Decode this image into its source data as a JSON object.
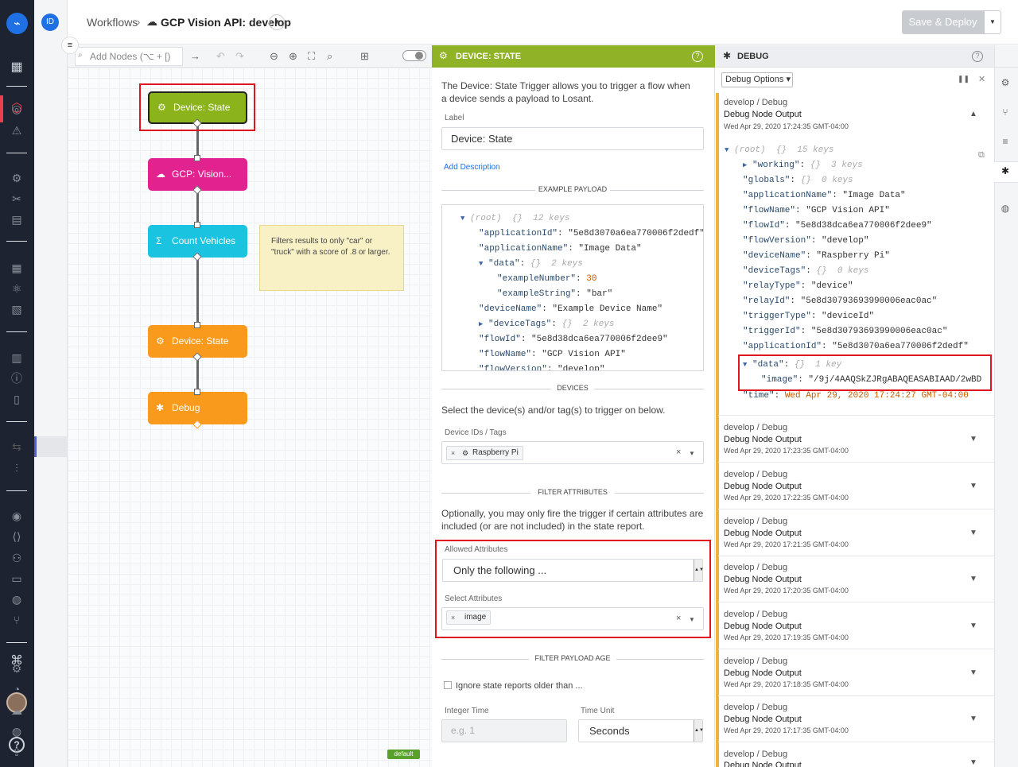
{
  "header": {
    "user_initials": "ID",
    "breadcrumb": "Workflows",
    "crumb_sep": "›",
    "workflow_name": "GCP Vision API: develop",
    "save_deploy": "Save & Deploy"
  },
  "toolbar": {
    "add_nodes_placeholder": "Add Nodes (⌥ + [)"
  },
  "nodes": [
    {
      "label": "Device: State",
      "color": "#8ab31c"
    },
    {
      "label": "GCP: Vision...",
      "color": "#e2238f"
    },
    {
      "label": "Count Vehicles",
      "color": "#1ac3e0"
    },
    {
      "label": "Device: State",
      "color": "#f99a1d"
    },
    {
      "label": "Debug",
      "color": "#f99a1d"
    }
  ],
  "sticky_note": "Filters results to only \"car\" or \"truck\" with a score of .8 or larger.",
  "branch_tag": "default",
  "properties": {
    "title": "DEVICE: STATE",
    "description": "The Device: State Trigger allows you to trigger a flow when a device sends a payload to Losant.",
    "label_caption": "Label",
    "label_value": "Device: State",
    "add_description": "Add Description",
    "example_payload_title": "EXAMPLE PAYLOAD",
    "payload": {
      "root_meta": "(root)  {}  12 keys",
      "applicationId_key": "\"applicationId\"",
      "applicationId_val": "\"5e8d3070a6ea770006f2dedf\"",
      "applicationName_key": "\"applicationName\"",
      "applicationName_val": "\"Image Data\"",
      "data_key": "\"data\"",
      "data_meta": "{}  2 keys",
      "exampleNumber_key": "\"exampleNumber\"",
      "exampleNumber_val": "30",
      "exampleString_key": "\"exampleString\"",
      "exampleString_val": "\"bar\"",
      "deviceName_key": "\"deviceName\"",
      "deviceName_val": "\"Example Device Name\"",
      "deviceTags_key": "\"deviceTags\"",
      "deviceTags_meta": "{}  2 keys",
      "flowId_key": "\"flowId\"",
      "flowId_val": "\"5e8d38dca6ea770006f2dee9\"",
      "flowName_key": "\"flowName\"",
      "flowName_val": "\"GCP Vision API\"",
      "flowVersion_key": "\"flowVersion\"",
      "flowVersion_val": "\"develop\""
    },
    "devices_title": "DEVICES",
    "devices_text": "Select the device(s) and/or tag(s) to trigger on below.",
    "device_ids_label": "Device IDs / Tags",
    "device_chip": "Raspberry Pi",
    "filter_attrs_title": "FILTER ATTRIBUTES",
    "filter_attrs_text": "Optionally, you may only fire the trigger if certain attributes are included (or are not included) in the state report.",
    "allowed_label": "Allowed Attributes",
    "allowed_value": "Only the following ...",
    "select_attrs_label": "Select Attributes",
    "attr_chip": "image",
    "filter_age_title": "FILTER PAYLOAD AGE",
    "ignore_label": "Ignore state reports older than ...",
    "integer_time_label": "Integer Time",
    "integer_time_placeholder": "e.g. 1",
    "time_unit_label": "Time Unit",
    "time_unit_value": "Seconds"
  },
  "debug": {
    "title": "DEBUG",
    "options": "Debug Options",
    "messages": [
      {
        "path": "develop / Debug",
        "title": "Debug Node Output",
        "time": "Wed Apr 29, 2020 17:24:35 GMT-04:00"
      },
      {
        "path": "develop / Debug",
        "title": "Debug Node Output",
        "time": "Wed Apr 29, 2020 17:23:35 GMT-04:00"
      },
      {
        "path": "develop / Debug",
        "title": "Debug Node Output",
        "time": "Wed Apr 29, 2020 17:22:35 GMT-04:00"
      },
      {
        "path": "develop / Debug",
        "title": "Debug Node Output",
        "time": "Wed Apr 29, 2020 17:21:35 GMT-04:00"
      },
      {
        "path": "develop / Debug",
        "title": "Debug Node Output",
        "time": "Wed Apr 29, 2020 17:20:35 GMT-04:00"
      },
      {
        "path": "develop / Debug",
        "title": "Debug Node Output",
        "time": "Wed Apr 29, 2020 17:19:35 GMT-04:00"
      },
      {
        "path": "develop / Debug",
        "title": "Debug Node Output",
        "time": "Wed Apr 29, 2020 17:18:35 GMT-04:00"
      },
      {
        "path": "develop / Debug",
        "title": "Debug Node Output",
        "time": "Wed Apr 29, 2020 17:17:35 GMT-04:00"
      },
      {
        "path": "develop / Debug",
        "title": "Debug Node Output",
        "time": ""
      }
    ],
    "tree": {
      "root_meta": "(root)  {}  15 keys",
      "working_key": "\"working\"",
      "working_meta": "{}  3 keys",
      "globals_key": "\"globals\"",
      "globals_meta": "{}  0 keys",
      "applicationName_key": "\"applicationName\"",
      "applicationName_val": "\"Image Data\"",
      "flowName_key": "\"flowName\"",
      "flowName_val": "\"GCP Vision API\"",
      "flowId_key": "\"flowId\"",
      "flowId_val": "\"5e8d38dca6ea770006f2dee9\"",
      "flowVersion_key": "\"flowVersion\"",
      "flowVersion_val": "\"develop\"",
      "deviceName_key": "\"deviceName\"",
      "deviceName_val": "\"Raspberry Pi\"",
      "deviceTags_key": "\"deviceTags\"",
      "deviceTags_meta": "{}  0 keys",
      "relayType_key": "\"relayType\"",
      "relayType_val": "\"device\"",
      "relayId_key": "\"relayId\"",
      "relayId_val": "\"5e8d30793693990006eac0ac\"",
      "triggerType_key": "\"triggerType\"",
      "triggerType_val": "\"deviceId\"",
      "triggerId_key": "\"triggerId\"",
      "triggerId_val": "\"5e8d30793693990006eac0ac\"",
      "applicationId_key": "\"applicationId\"",
      "applicationId_val": "\"5e8d3070a6ea770006f2dedf\"",
      "data_key": "\"data\"",
      "data_meta": "{}  1 key",
      "image_key": "\"image\"",
      "image_val": "\"/9j/4AAQSkZJRgABAQEASABIAAD/2wBD",
      "time_key": "\"time\"",
      "time_val": "Wed Apr 29, 2020 17:24:27 GMT-04:00"
    }
  },
  "colors": {
    "accent": "#8fb226",
    "highlight": "#e0141e",
    "debug_bar": "#f3b236",
    "rail": "#1d2330"
  }
}
